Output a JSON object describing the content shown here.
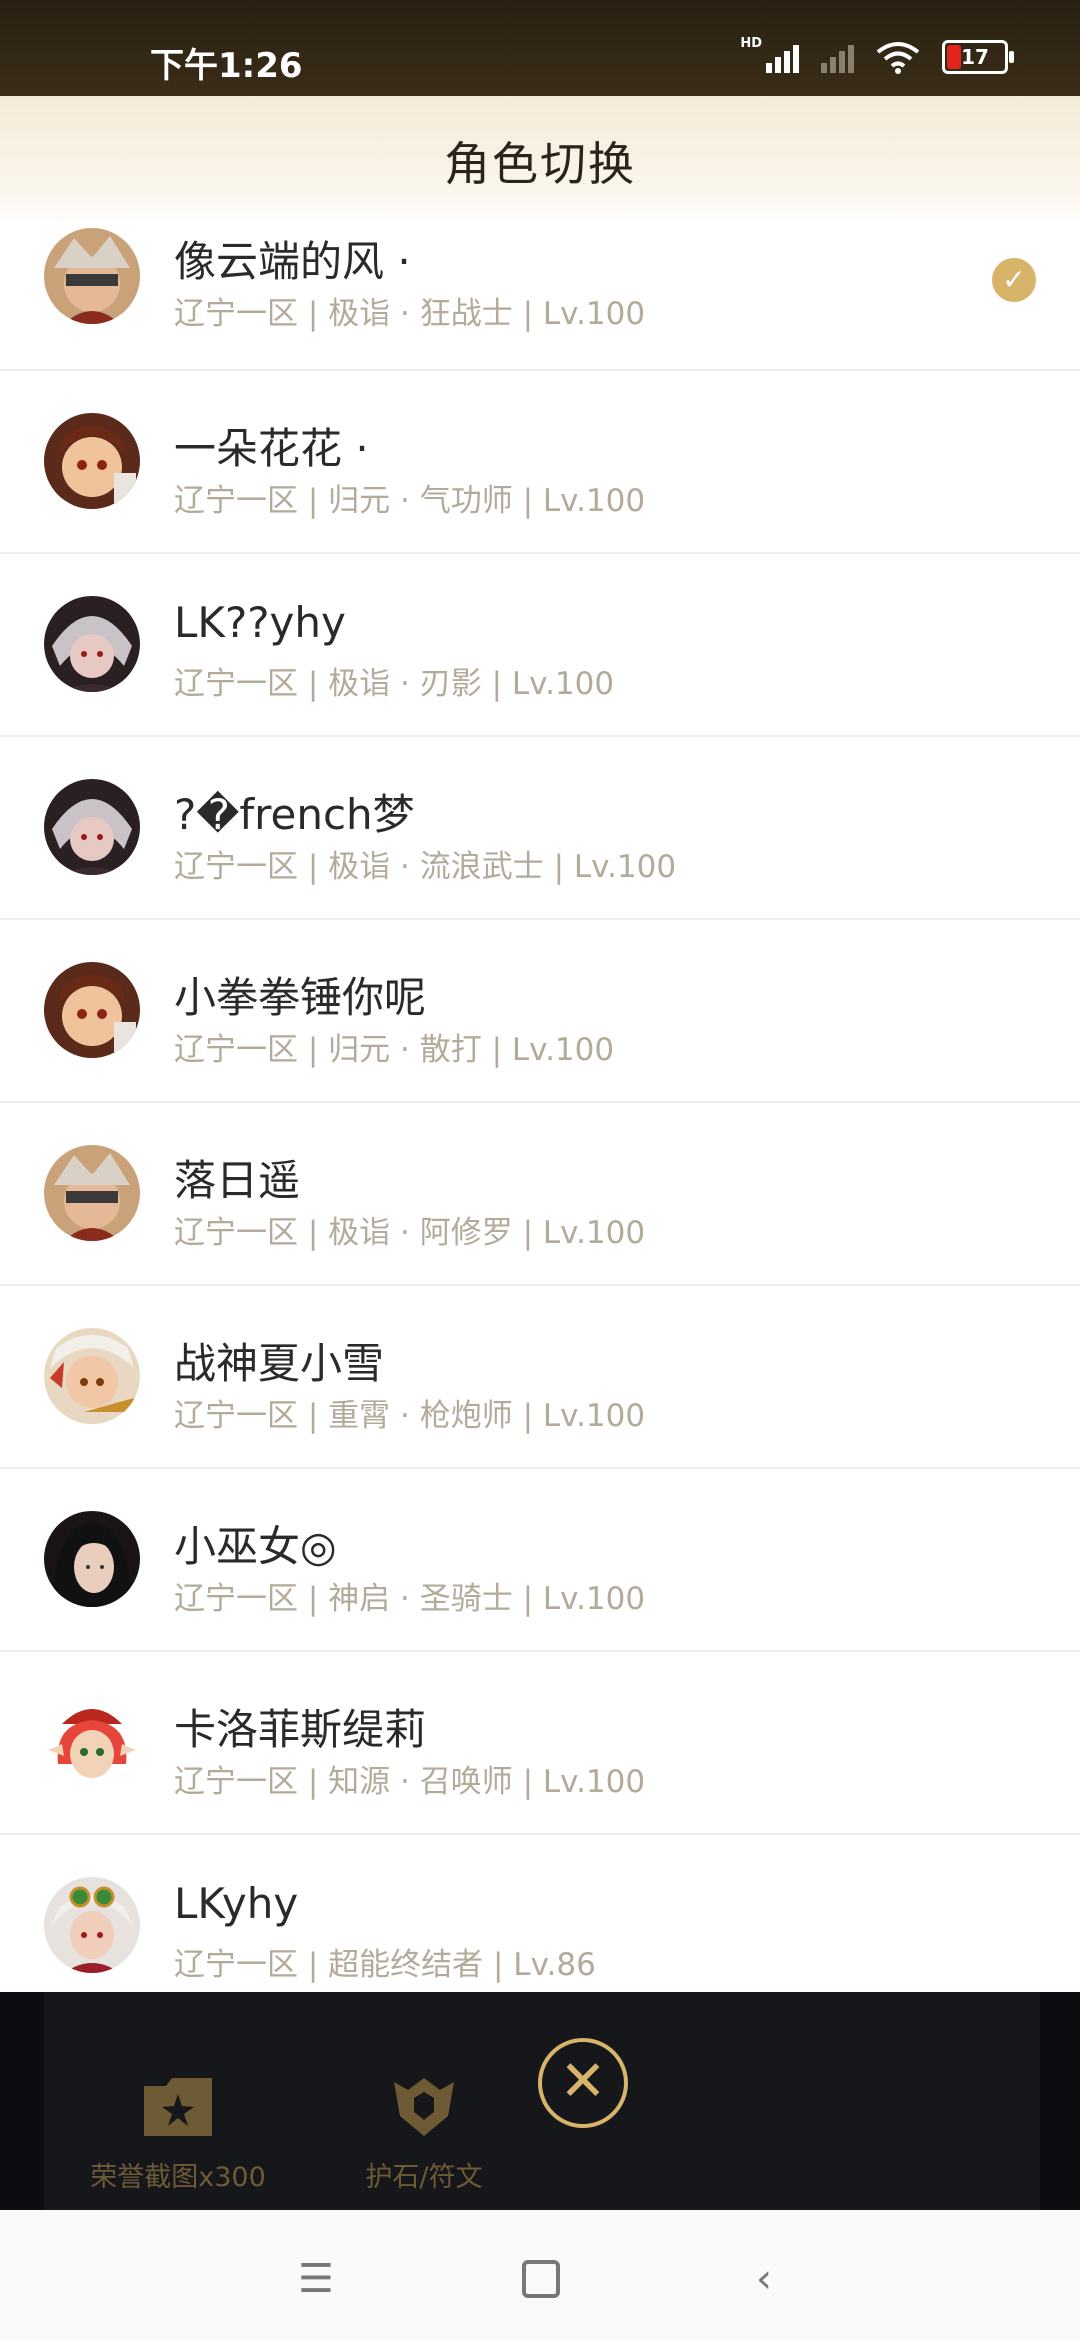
{
  "status_bar": {
    "time": "下午1:26",
    "hd": "HD",
    "battery": "17"
  },
  "header": {
    "title": "角色切换"
  },
  "roles": [
    {
      "name": "像云端的风 ·",
      "info": "辽宁一区 | 极诣 · 狂战士 | Lv.100",
      "selected": true,
      "avatar": "berserker-avatar"
    },
    {
      "name": "一朵花花 ·",
      "info": "辽宁一区 | 归元 · 气功师 | Lv.100",
      "avatar": "fighter-avatar"
    },
    {
      "name": "LK??yhy",
      "info": "辽宁一区 | 极诣 · 刃影 | Lv.100",
      "avatar": "blade-avatar"
    },
    {
      "name": "?�french梦",
      "info": "辽宁一区 | 极诣 · 流浪武士 | Lv.100",
      "avatar": "blade-avatar"
    },
    {
      "name": "小拳拳锤你呢",
      "info": "辽宁一区 | 归元 · 散打 | Lv.100",
      "avatar": "fighter-avatar"
    },
    {
      "name": "落日遥",
      "info": "辽宁一区 | 极诣 · 阿修罗 | Lv.100",
      "avatar": "berserker-avatar"
    },
    {
      "name": "战神夏小雪",
      "info": "辽宁一区 | 重霄 · 枪炮师 | Lv.100",
      "avatar": "gunner-avatar"
    },
    {
      "name": "小巫女◎",
      "info": "辽宁一区 | 神启 · 圣骑士 | Lv.100",
      "avatar": "priestess-avatar"
    },
    {
      "name": "卡洛菲斯缇莉",
      "info": "辽宁一区 | 知源 · 召唤师 | Lv.100",
      "avatar": "mage-avatar"
    },
    {
      "name": "LKyhy",
      "info": "辽宁一区 | 超能终结者 | Lv.86",
      "avatar": "goggles-avatar"
    }
  ],
  "bottom_tools": [
    {
      "label": "荣誉截图x300",
      "icon": "photo-folder-icon"
    },
    {
      "label": "护石/符文",
      "icon": "shield-rune-icon"
    }
  ],
  "nav": {
    "menu": "☰",
    "back": "‹"
  }
}
